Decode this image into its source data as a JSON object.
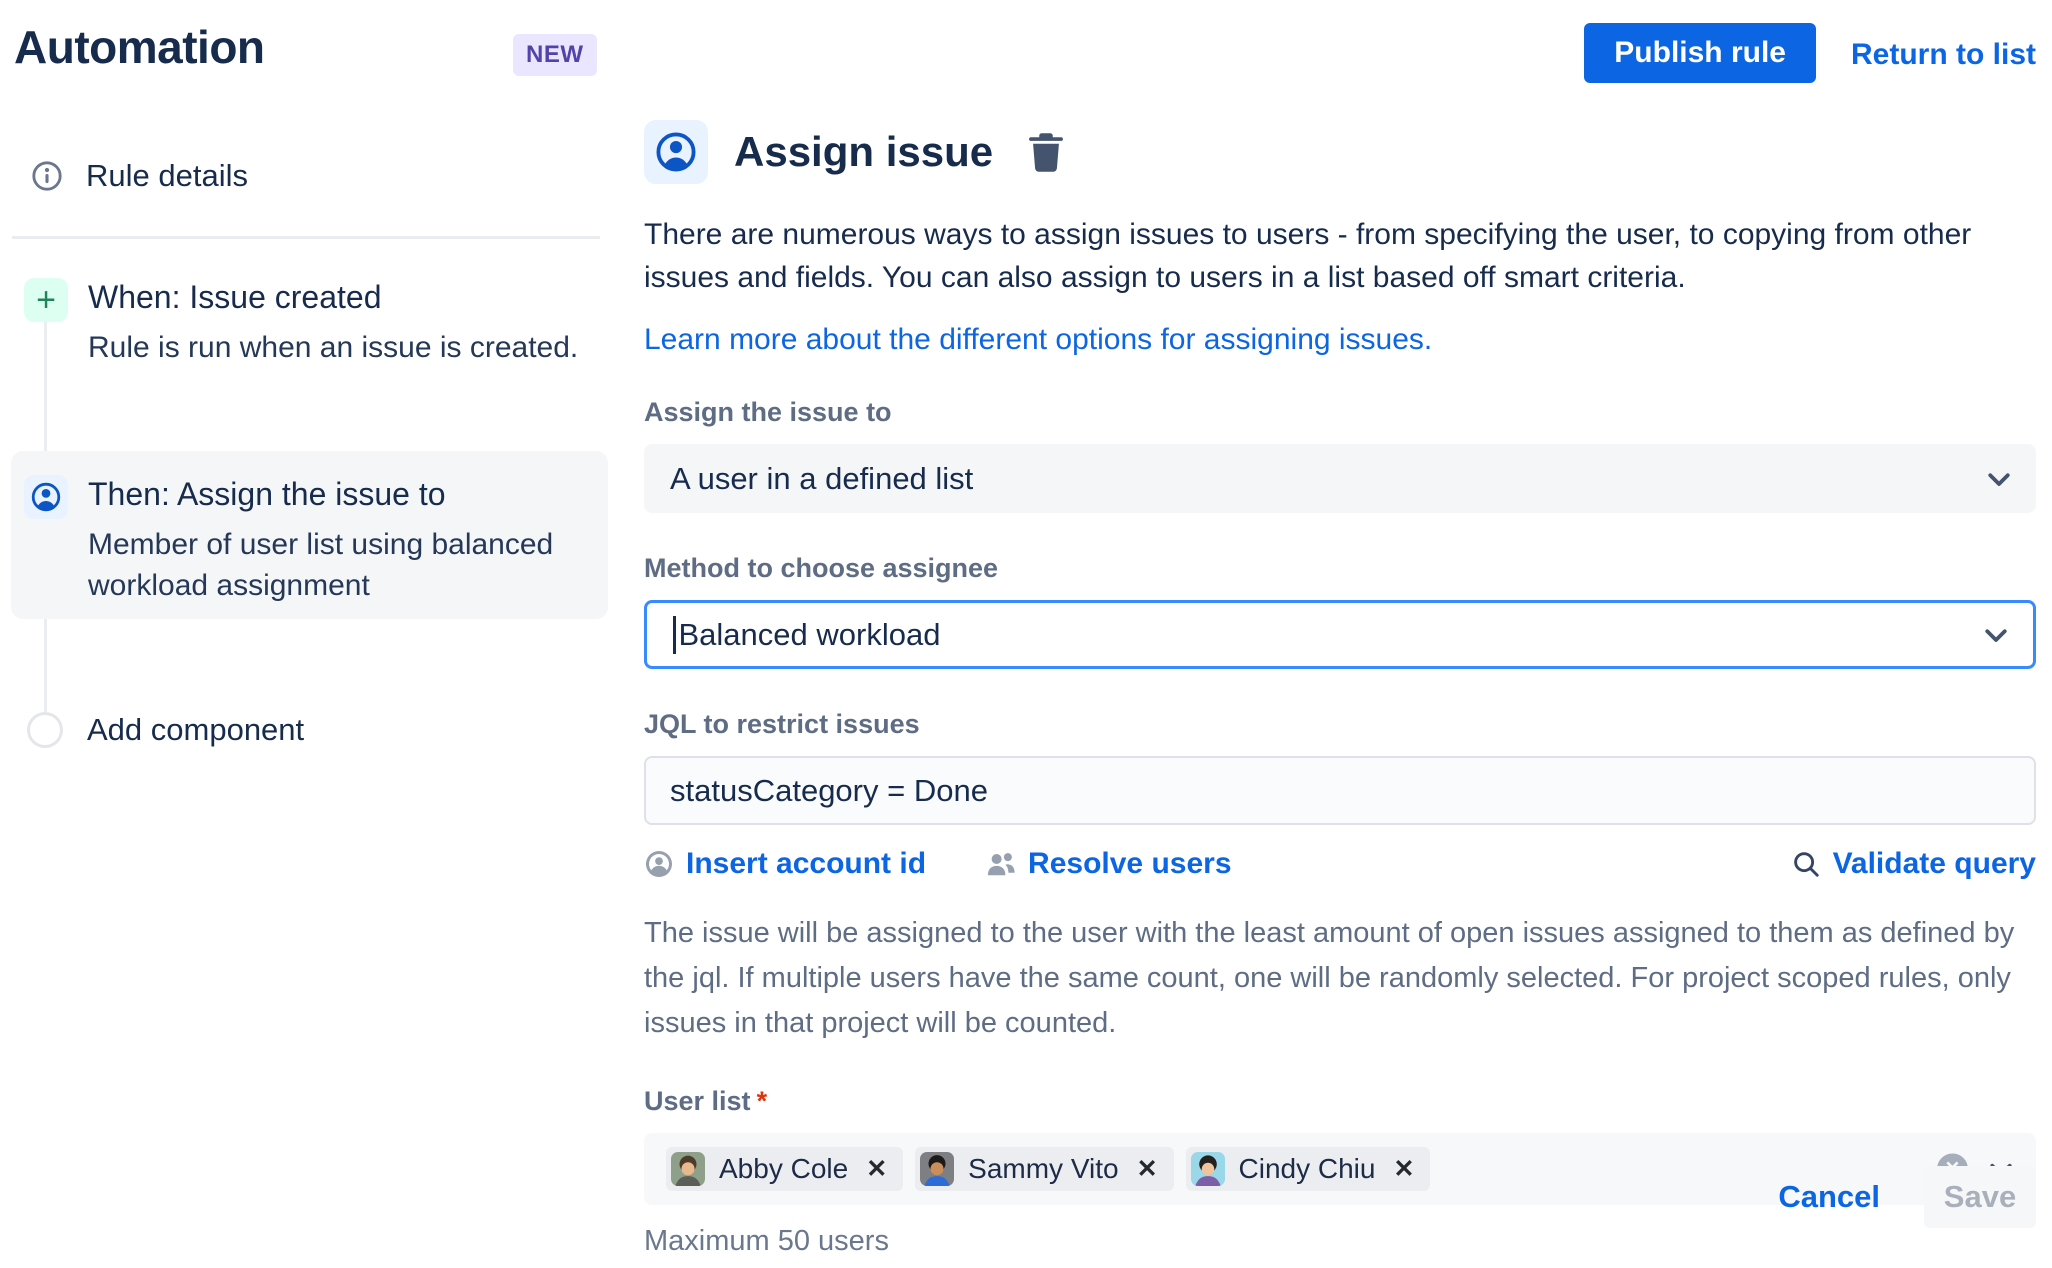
{
  "header": {
    "title": "Automation",
    "badge": "NEW",
    "publish_label": "Publish rule",
    "return_label": "Return to list"
  },
  "sidebar": {
    "rule_details_label": "Rule details",
    "when": {
      "title": "When: Issue created",
      "description": "Rule is run when an issue is created."
    },
    "then": {
      "title": "Then: Assign the issue to",
      "description": "Member of user list using balanced workload assignment"
    },
    "add_component_label": "Add component"
  },
  "main": {
    "title": "Assign issue",
    "description": "There are numerous ways to assign issues to users - from specifying the user, to copying from other issues and fields. You can also assign to users in a list based off smart criteria.",
    "learn_more": "Learn more about the different options for assigning issues.",
    "assign_to": {
      "label": "Assign the issue to",
      "value": "A user in a defined list"
    },
    "method": {
      "label": "Method to choose assignee",
      "value": "Balanced workload"
    },
    "jql": {
      "label": "JQL to restrict issues",
      "value": "statusCategory = Done"
    },
    "actions": {
      "insert_account_id": "Insert account id",
      "resolve_users": "Resolve users",
      "validate_query": "Validate query"
    },
    "helper": "The issue will be assigned to the user with the least amount of open issues assigned to them as defined by the jql. If multiple users have the same count, one will be randomly selected. For project scoped rules, only issues in that project will be counted.",
    "user_list": {
      "label": "User list",
      "required_marker": "*",
      "users": [
        {
          "name": "Abby Cole",
          "avatar_colors": {
            "bg": "#8FA08A",
            "hair": "#4E3B2A",
            "skin": "#E8B98E",
            "shirt": "#5B5F57"
          }
        },
        {
          "name": "Sammy Vito",
          "avatar_colors": {
            "bg": "#7E7F83",
            "hair": "#1E1A18",
            "skin": "#C98E5A",
            "shirt": "#2D6BD6"
          }
        },
        {
          "name": "Cindy Chiu",
          "avatar_colors": {
            "bg": "#9AD7E8",
            "hair": "#24201F",
            "skin": "#EFC49C",
            "shirt": "#7B5EA7"
          }
        }
      ],
      "max_helper": "Maximum 50 users"
    },
    "footer": {
      "cancel_label": "Cancel",
      "save_label": "Save"
    }
  },
  "icons": {
    "remove_glyph": "✕",
    "plus_glyph": "+",
    "clear_glyph": "✕"
  },
  "colors": {
    "brand_blue": "#0C66E4",
    "focus_border": "#388BFF",
    "badge_bg": "#EAE6FF",
    "badge_text": "#5243AA",
    "green_icon_bg": "#DCFFF1",
    "green_icon": "#1F845A",
    "person_icon_bg": "#E9F2FF",
    "person_icon": "#0C55C4",
    "required": "#DE350B",
    "label_text": "#5E6C84",
    "body_text": "#172B4D"
  }
}
